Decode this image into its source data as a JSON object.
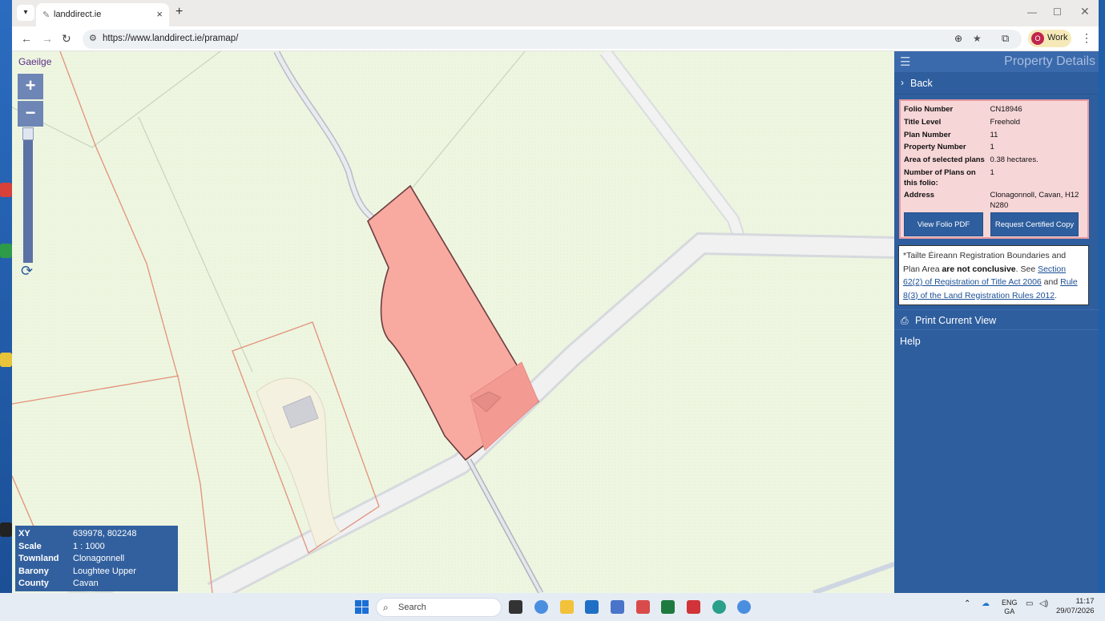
{
  "browser": {
    "tab_title": "landdirect.ie",
    "url": "https://www.landdirect.ie/pramap/",
    "profile_label": "Work",
    "profile_initial": "O"
  },
  "map": {
    "language_link": "Gaeilge",
    "zoom_in": "+",
    "zoom_out": "−",
    "info": [
      {
        "key": "XY",
        "value": "639978, 802248"
      },
      {
        "key": "Scale",
        "value": "1 : 1000"
      },
      {
        "key": "Townland",
        "value": "Clonagonnell"
      },
      {
        "key": "Barony",
        "value": "Loughtee Upper"
      },
      {
        "key": "County",
        "value": "Cavan"
      }
    ]
  },
  "panel": {
    "title": "Property Details",
    "back": "Back",
    "details": [
      {
        "key": "Folio Number",
        "value": "CN18946"
      },
      {
        "key": "Title Level",
        "value": "Freehold"
      },
      {
        "key": "Plan Number",
        "value": "11"
      },
      {
        "key": "Property Number",
        "value": "1"
      },
      {
        "key": "Area of selected plans",
        "value": "0.38 hectares."
      },
      {
        "key": "Number of Plans on this folio:",
        "value": "1"
      },
      {
        "key": "Address",
        "value": "Clonagonnoll, Cavan, H12 N280"
      }
    ],
    "view_folio_btn": "View Folio PDF",
    "request_copy_btn": "Request Certified Copy",
    "notice": {
      "part1": "*Tailte Éireann Registration Boundaries and Plan Area ",
      "bold": "are not conclusive",
      "part2": ". See ",
      "link1": "Section 62(2) of Registration of Title Act 2006",
      "part3": " and ",
      "link2": "Rule 8(3) of the Land Registration Rules 2012",
      "part4": "."
    },
    "print": "Print Current View",
    "help": "Help"
  },
  "taskbar": {
    "search_label": "Search",
    "lang_top": "ENG",
    "lang_bottom": "GA",
    "time": "11:17",
    "date": "29/07/2026"
  },
  "colors": {
    "panel_bg": "#2e5e9e",
    "parcel_fill": "#f8a9a0",
    "map_bg": "#eef6e1",
    "details_bg": "#f7d6d8"
  }
}
